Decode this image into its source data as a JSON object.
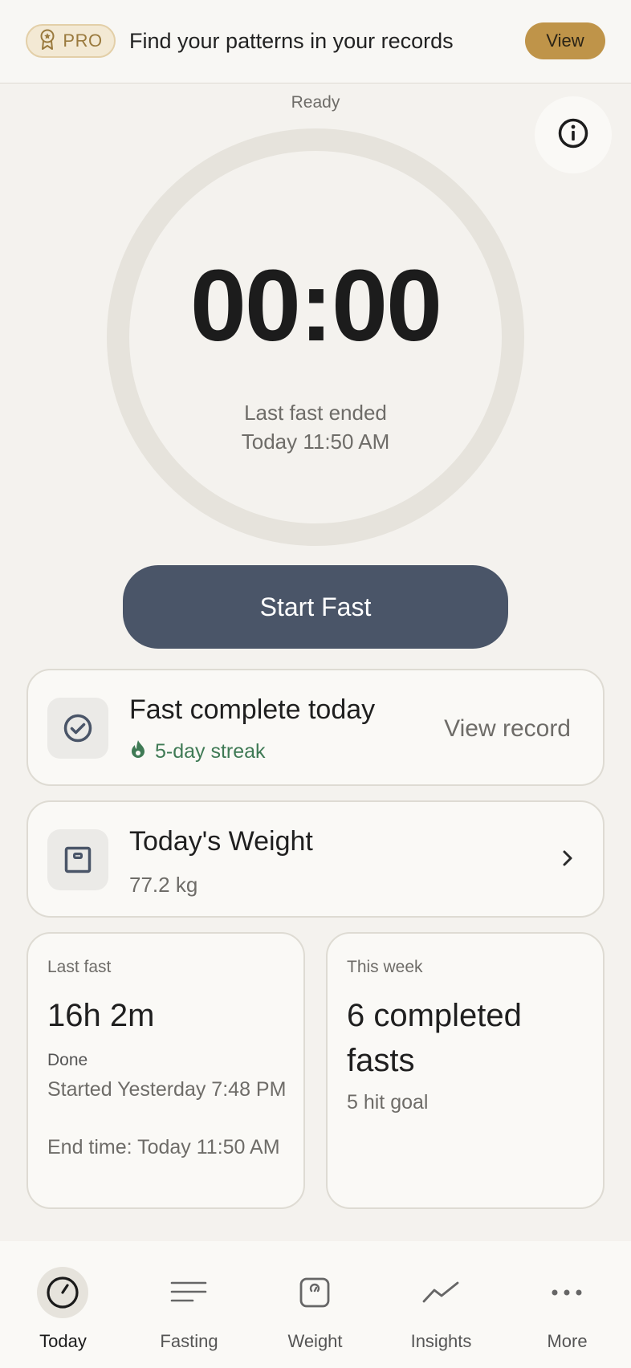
{
  "promo": {
    "badge": "PRO",
    "text": "Find your patterns in your records",
    "view_label": "View"
  },
  "timer": {
    "status": "Ready",
    "time": "00:00",
    "last_fast_line1": "Last fast ended",
    "last_fast_line2": "Today 11:50 AM",
    "progress": 0
  },
  "start_button": "Start Fast",
  "fast_card": {
    "title": "Fast complete today",
    "streak": "5-day streak",
    "action": "View record"
  },
  "weight_card": {
    "title": "Today's Weight",
    "value": "77.2 kg"
  },
  "last_fast": {
    "label": "Last fast",
    "duration": "16h 2m",
    "status": "Done",
    "started": "Started Yesterday 7:48 PM",
    "ended": "End time: Today 11:50 AM"
  },
  "this_week": {
    "label": "This week",
    "summary": "6 completed fasts",
    "goal": "5 hit goal"
  },
  "nav": {
    "items": [
      {
        "label": "Today",
        "icon": "clock-icon"
      },
      {
        "label": "Fasting",
        "icon": "lines-icon"
      },
      {
        "label": "Weight",
        "icon": "scale-icon"
      },
      {
        "label": "Insights",
        "icon": "trend-icon"
      },
      {
        "label": "More",
        "icon": "more-icon"
      }
    ],
    "active": "Today"
  },
  "colors": {
    "accent_gold": "#bf9449",
    "primary_button": "#4a5568",
    "streak_green": "#3f7a55",
    "ring": "#e6e3dc"
  }
}
